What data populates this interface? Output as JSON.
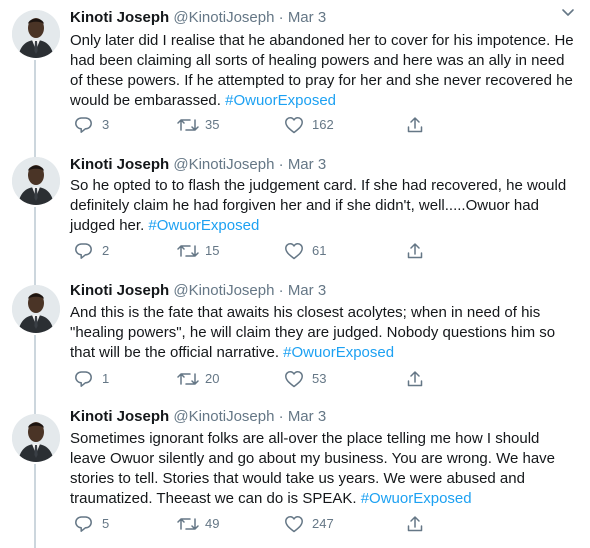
{
  "tweets": [
    {
      "author_name": "Kinoti Joseph",
      "handle": "@KinotiJoseph",
      "separator": "·",
      "date": "Mar 3",
      "text": "Only later did I realise that he abandoned her to cover for his impotence. He had been claiming all sorts of healing powers and here was an ally in need of these powers. If he attempted to pray for her and she never recovered he would be embarassed.",
      "hashtag": "#OwuorExposed",
      "replies": "3",
      "retweets": "35",
      "likes": "162"
    },
    {
      "author_name": "Kinoti Joseph",
      "handle": "@KinotiJoseph",
      "separator": "·",
      "date": "Mar 3",
      "text": "So he opted to to flash the judgement card. If she had recovered, he would definitely claim he had forgiven her and if she didn't, well.....Owuor had judged her.",
      "hashtag": "#OwuorExposed",
      "replies": "2",
      "retweets": "15",
      "likes": "61"
    },
    {
      "author_name": "Kinoti Joseph",
      "handle": "@KinotiJoseph",
      "separator": "·",
      "date": "Mar 3",
      "text": "And this is the fate that awaits his closest acolytes; when in need of his \"healing powers\", he will claim they are judged. Nobody questions him so that will be the official narrative.",
      "hashtag": "#OwuorExposed",
      "replies": "1",
      "retweets": "20",
      "likes": "53"
    },
    {
      "author_name": "Kinoti Joseph",
      "handle": "@KinotiJoseph",
      "separator": "·",
      "date": "Mar 3",
      "text": "Sometimes ignorant folks are all-over the place telling me how I should leave Owuor silently and go about my business. You are wrong. We have stories to tell. Stories that would take us years. We were abused and traumatized. Theeast we can do is SPEAK.",
      "hashtag": "#OwuorExposed",
      "replies": "5",
      "retweets": "49",
      "likes": "247"
    }
  ],
  "icons": {
    "reply": "reply-icon",
    "retweet": "retweet-icon",
    "like": "heart-icon",
    "share": "share-icon",
    "more": "chevron-down-icon"
  },
  "colors": {
    "text": "#14171a",
    "secondary": "#657786",
    "hashtag": "#1da1f2",
    "thread_line": "#ccd6dd"
  }
}
